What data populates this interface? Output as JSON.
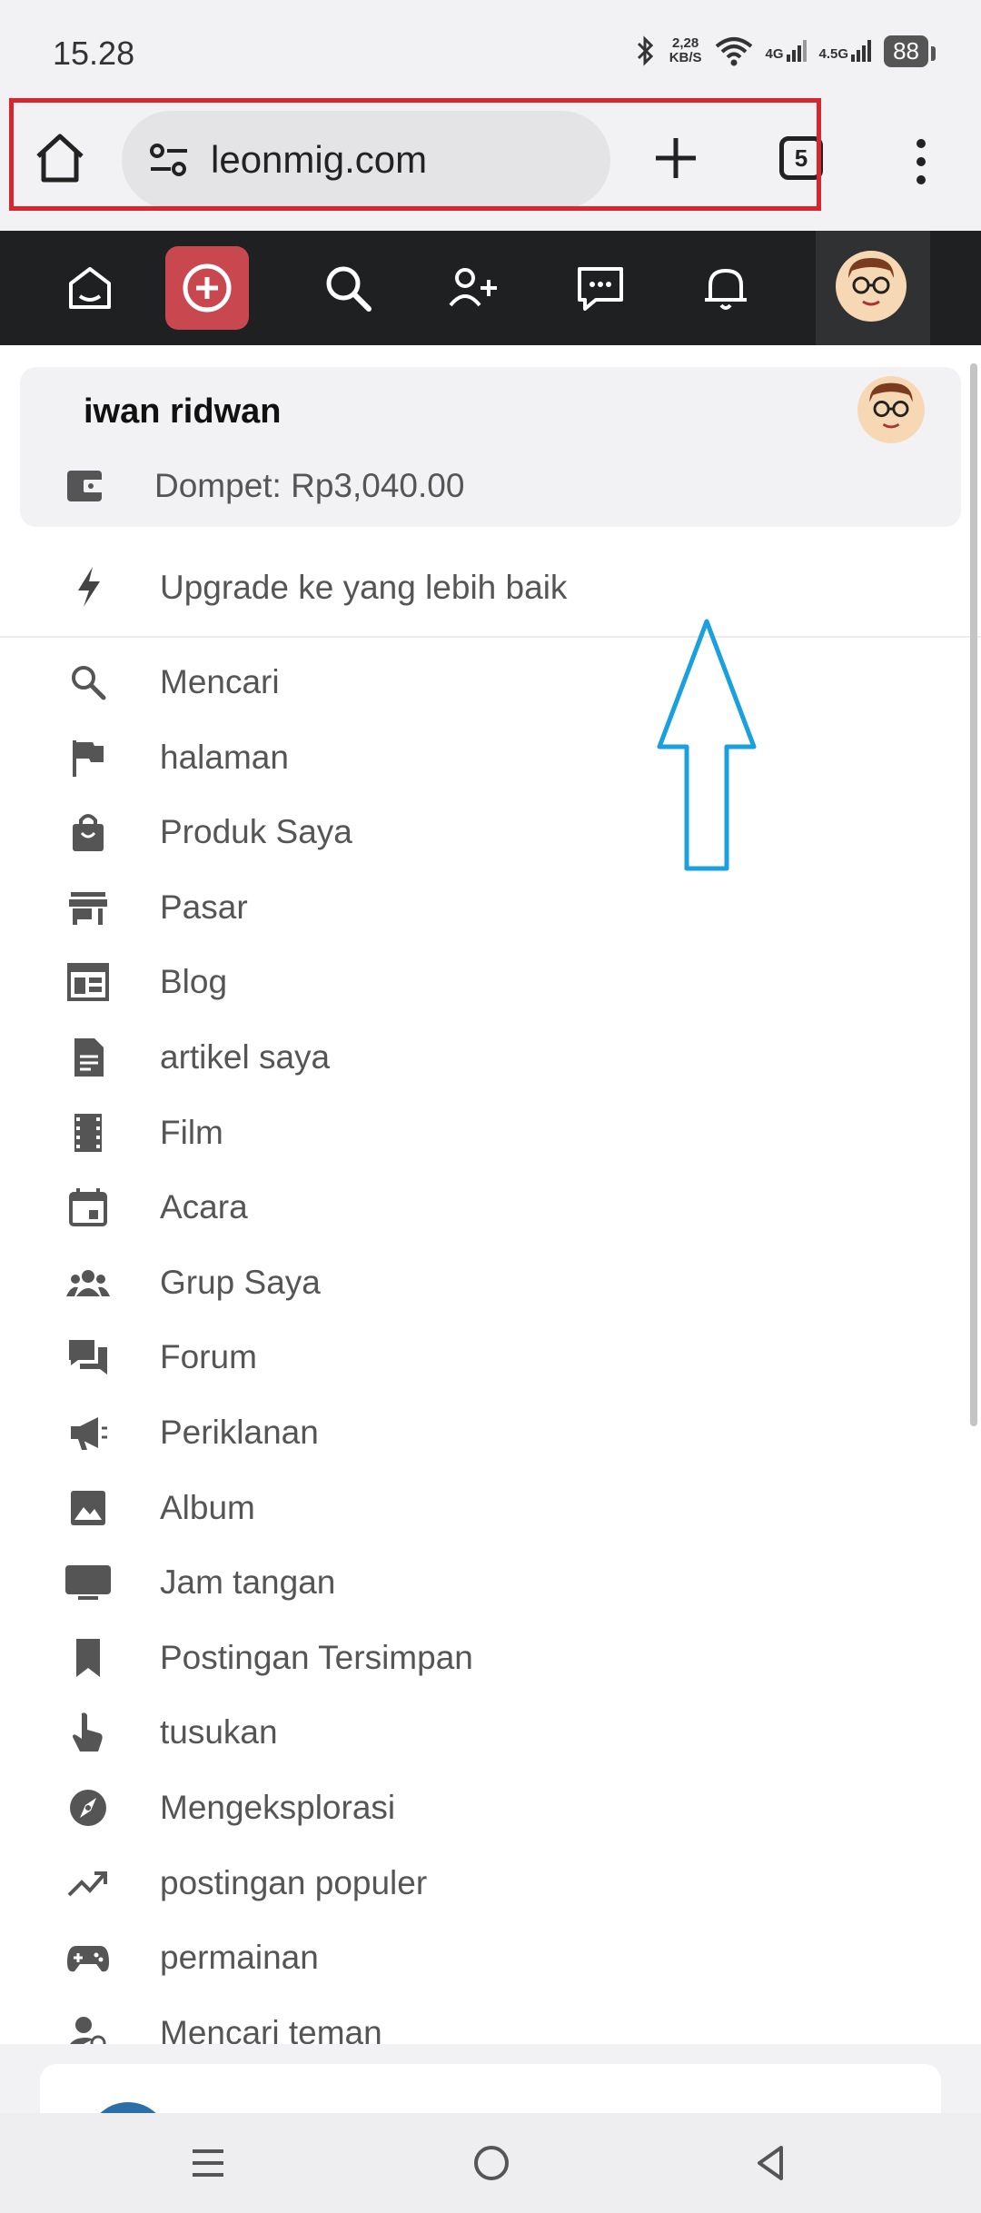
{
  "status_bar": {
    "time": "15.28",
    "speed_value": "2,28",
    "speed_unit": "KB/S",
    "net1": "4G",
    "net2": "4.5G",
    "battery": "88"
  },
  "browser": {
    "url": "leonmig.com",
    "tab_count": "5"
  },
  "user": {
    "name": "iwan ridwan",
    "wallet": "Dompet: Rp3,040.00",
    "upgrade": "Upgrade ke yang lebih baik"
  },
  "menu_items": [
    {
      "label": "Mencari",
      "icon": "search-icon"
    },
    {
      "label": "halaman",
      "icon": "flag-icon"
    },
    {
      "label": "Produk Saya",
      "icon": "shopping-bag-icon"
    },
    {
      "label": "Pasar",
      "icon": "store-icon"
    },
    {
      "label": "Blog",
      "icon": "blog-icon"
    },
    {
      "label": "artikel saya",
      "icon": "article-icon"
    },
    {
      "label": "Film",
      "icon": "film-icon"
    },
    {
      "label": "Acara",
      "icon": "calendar-icon"
    },
    {
      "label": "Grup Saya",
      "icon": "group-icon"
    },
    {
      "label": "Forum",
      "icon": "forum-icon"
    },
    {
      "label": "Periklanan",
      "icon": "megaphone-icon"
    },
    {
      "label": "Album",
      "icon": "image-icon"
    },
    {
      "label": "Jam tangan",
      "icon": "tv-icon"
    },
    {
      "label": "Postingan Tersimpan",
      "icon": "bookmark-icon"
    },
    {
      "label": "tusukan",
      "icon": "pointer-icon"
    },
    {
      "label": "Mengeksplorasi",
      "icon": "compass-icon"
    },
    {
      "label": "postingan populer",
      "icon": "trending-icon"
    },
    {
      "label": "permainan",
      "icon": "gamepad-icon"
    },
    {
      "label": "Mencari teman",
      "icon": "person-search-icon"
    }
  ],
  "colors": {
    "nav_bg": "#1f2021",
    "accent": "#c9474f",
    "highlight": "#d7262e",
    "arrow": "#1aa0e0"
  }
}
